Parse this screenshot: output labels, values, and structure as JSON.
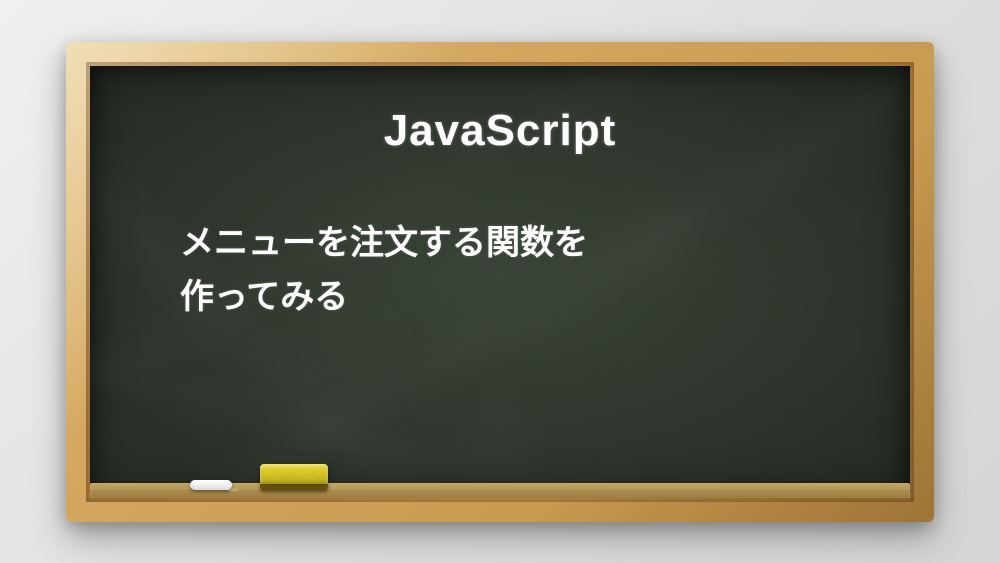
{
  "board": {
    "title": "JavaScript",
    "subtitle_line1": "メニューを注文する関数を",
    "subtitle_line2": "作ってみる"
  }
}
